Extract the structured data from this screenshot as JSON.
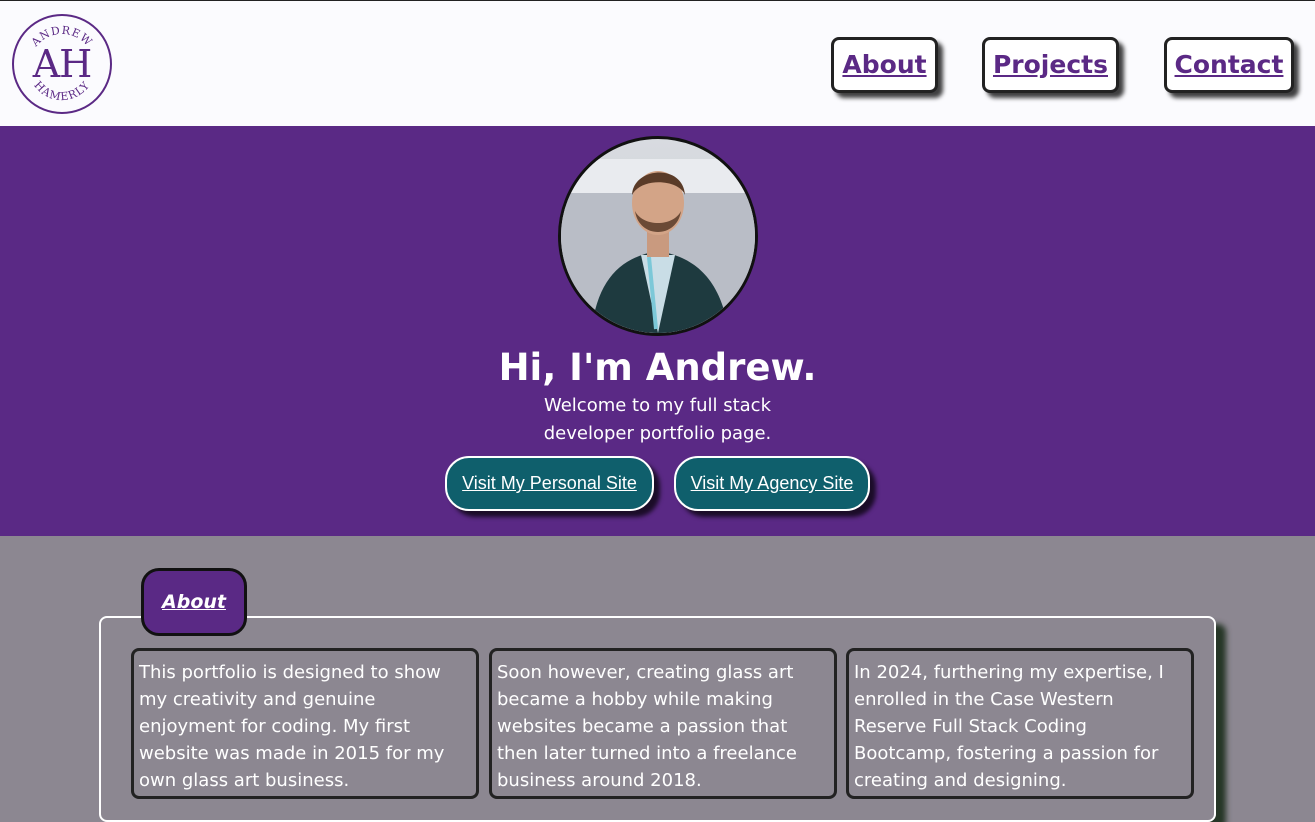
{
  "header": {
    "logo": {
      "initials": "AH",
      "top_text": "ANDREW",
      "bottom_text": "HAMERLY",
      "color": "#5b2985"
    },
    "nav": [
      {
        "label": "About"
      },
      {
        "label": "Projects"
      },
      {
        "label": "Contact"
      }
    ]
  },
  "hero": {
    "background": "#5a2985",
    "title": "Hi, I'm Andrew.",
    "subtitle": "Welcome to my full stack developer portfolio page.",
    "buttons": [
      {
        "label": "Visit My Personal Site"
      },
      {
        "label": "Visit My Agency Site"
      }
    ]
  },
  "about": {
    "tab_label": "About",
    "cards": [
      {
        "text": "This portfolio is designed to show my creativity and genuine enjoyment for coding. My first website was made in 2015 for my own glass art business."
      },
      {
        "text": "Soon however, creating glass art became a hobby while making websites became a passion that then later turned into a freelance business around 2018."
      },
      {
        "text": "In 2024, furthering my expertise, I enrolled in the Case Western Reserve Full Stack Coding Bootcamp, fostering a passion for creating and designing."
      }
    ]
  }
}
